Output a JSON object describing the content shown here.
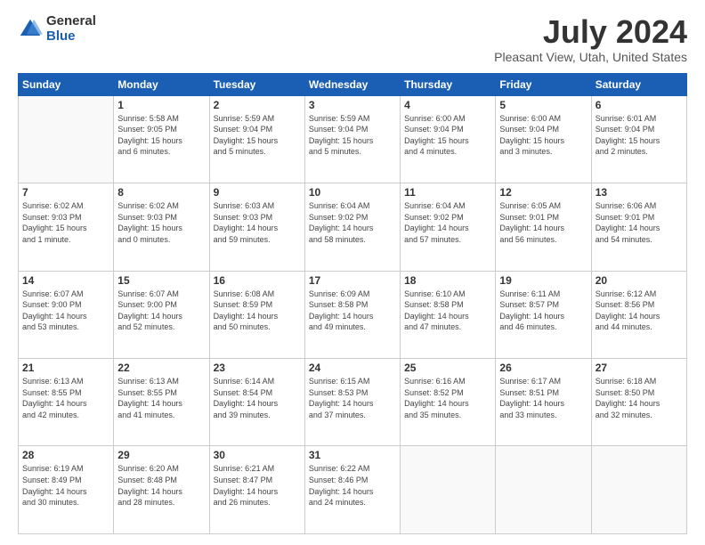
{
  "logo": {
    "general": "General",
    "blue": "Blue"
  },
  "title": {
    "month": "July 2024",
    "location": "Pleasant View, Utah, United States"
  },
  "weekdays": [
    "Sunday",
    "Monday",
    "Tuesday",
    "Wednesday",
    "Thursday",
    "Friday",
    "Saturday"
  ],
  "weeks": [
    [
      {
        "day": "",
        "info": ""
      },
      {
        "day": "1",
        "info": "Sunrise: 5:58 AM\nSunset: 9:05 PM\nDaylight: 15 hours\nand 6 minutes."
      },
      {
        "day": "2",
        "info": "Sunrise: 5:59 AM\nSunset: 9:04 PM\nDaylight: 15 hours\nand 5 minutes."
      },
      {
        "day": "3",
        "info": "Sunrise: 5:59 AM\nSunset: 9:04 PM\nDaylight: 15 hours\nand 5 minutes."
      },
      {
        "day": "4",
        "info": "Sunrise: 6:00 AM\nSunset: 9:04 PM\nDaylight: 15 hours\nand 4 minutes."
      },
      {
        "day": "5",
        "info": "Sunrise: 6:00 AM\nSunset: 9:04 PM\nDaylight: 15 hours\nand 3 minutes."
      },
      {
        "day": "6",
        "info": "Sunrise: 6:01 AM\nSunset: 9:04 PM\nDaylight: 15 hours\nand 2 minutes."
      }
    ],
    [
      {
        "day": "7",
        "info": "Sunrise: 6:02 AM\nSunset: 9:03 PM\nDaylight: 15 hours\nand 1 minute."
      },
      {
        "day": "8",
        "info": "Sunrise: 6:02 AM\nSunset: 9:03 PM\nDaylight: 15 hours\nand 0 minutes."
      },
      {
        "day": "9",
        "info": "Sunrise: 6:03 AM\nSunset: 9:03 PM\nDaylight: 14 hours\nand 59 minutes."
      },
      {
        "day": "10",
        "info": "Sunrise: 6:04 AM\nSunset: 9:02 PM\nDaylight: 14 hours\nand 58 minutes."
      },
      {
        "day": "11",
        "info": "Sunrise: 6:04 AM\nSunset: 9:02 PM\nDaylight: 14 hours\nand 57 minutes."
      },
      {
        "day": "12",
        "info": "Sunrise: 6:05 AM\nSunset: 9:01 PM\nDaylight: 14 hours\nand 56 minutes."
      },
      {
        "day": "13",
        "info": "Sunrise: 6:06 AM\nSunset: 9:01 PM\nDaylight: 14 hours\nand 54 minutes."
      }
    ],
    [
      {
        "day": "14",
        "info": "Sunrise: 6:07 AM\nSunset: 9:00 PM\nDaylight: 14 hours\nand 53 minutes."
      },
      {
        "day": "15",
        "info": "Sunrise: 6:07 AM\nSunset: 9:00 PM\nDaylight: 14 hours\nand 52 minutes."
      },
      {
        "day": "16",
        "info": "Sunrise: 6:08 AM\nSunset: 8:59 PM\nDaylight: 14 hours\nand 50 minutes."
      },
      {
        "day": "17",
        "info": "Sunrise: 6:09 AM\nSunset: 8:58 PM\nDaylight: 14 hours\nand 49 minutes."
      },
      {
        "day": "18",
        "info": "Sunrise: 6:10 AM\nSunset: 8:58 PM\nDaylight: 14 hours\nand 47 minutes."
      },
      {
        "day": "19",
        "info": "Sunrise: 6:11 AM\nSunset: 8:57 PM\nDaylight: 14 hours\nand 46 minutes."
      },
      {
        "day": "20",
        "info": "Sunrise: 6:12 AM\nSunset: 8:56 PM\nDaylight: 14 hours\nand 44 minutes."
      }
    ],
    [
      {
        "day": "21",
        "info": "Sunrise: 6:13 AM\nSunset: 8:55 PM\nDaylight: 14 hours\nand 42 minutes."
      },
      {
        "day": "22",
        "info": "Sunrise: 6:13 AM\nSunset: 8:55 PM\nDaylight: 14 hours\nand 41 minutes."
      },
      {
        "day": "23",
        "info": "Sunrise: 6:14 AM\nSunset: 8:54 PM\nDaylight: 14 hours\nand 39 minutes."
      },
      {
        "day": "24",
        "info": "Sunrise: 6:15 AM\nSunset: 8:53 PM\nDaylight: 14 hours\nand 37 minutes."
      },
      {
        "day": "25",
        "info": "Sunrise: 6:16 AM\nSunset: 8:52 PM\nDaylight: 14 hours\nand 35 minutes."
      },
      {
        "day": "26",
        "info": "Sunrise: 6:17 AM\nSunset: 8:51 PM\nDaylight: 14 hours\nand 33 minutes."
      },
      {
        "day": "27",
        "info": "Sunrise: 6:18 AM\nSunset: 8:50 PM\nDaylight: 14 hours\nand 32 minutes."
      }
    ],
    [
      {
        "day": "28",
        "info": "Sunrise: 6:19 AM\nSunset: 8:49 PM\nDaylight: 14 hours\nand 30 minutes."
      },
      {
        "day": "29",
        "info": "Sunrise: 6:20 AM\nSunset: 8:48 PM\nDaylight: 14 hours\nand 28 minutes."
      },
      {
        "day": "30",
        "info": "Sunrise: 6:21 AM\nSunset: 8:47 PM\nDaylight: 14 hours\nand 26 minutes."
      },
      {
        "day": "31",
        "info": "Sunrise: 6:22 AM\nSunset: 8:46 PM\nDaylight: 14 hours\nand 24 minutes."
      },
      {
        "day": "",
        "info": ""
      },
      {
        "day": "",
        "info": ""
      },
      {
        "day": "",
        "info": ""
      }
    ]
  ]
}
